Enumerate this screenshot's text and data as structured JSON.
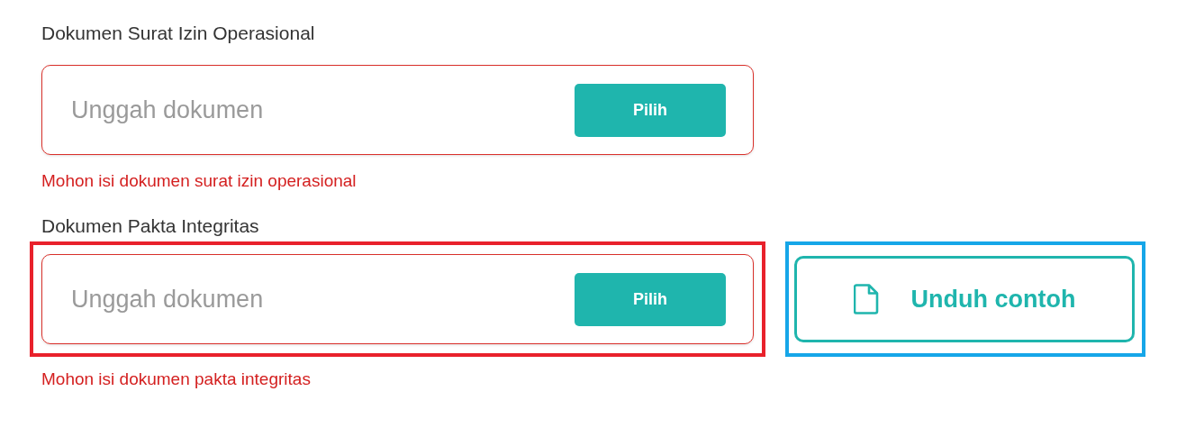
{
  "sections": [
    {
      "label": "Dokumen Surat Izin Operasional",
      "field": {
        "placeholder": "Unggah dokumen",
        "button": "Pilih",
        "invalid": true,
        "highlighted": false
      },
      "error": "Mohon isi dokumen surat izin operasional"
    },
    {
      "label": "Dokumen Pakta Integritas",
      "field": {
        "placeholder": "Unggah dokumen",
        "button": "Pilih",
        "invalid": true,
        "highlighted": true,
        "color": "#e8212b"
      },
      "error": "Mohon isi dokumen pakta integritas",
      "sample_button": {
        "label": "Unduh contoh",
        "highlighted": true,
        "color": "#16a6e8"
      }
    }
  ]
}
